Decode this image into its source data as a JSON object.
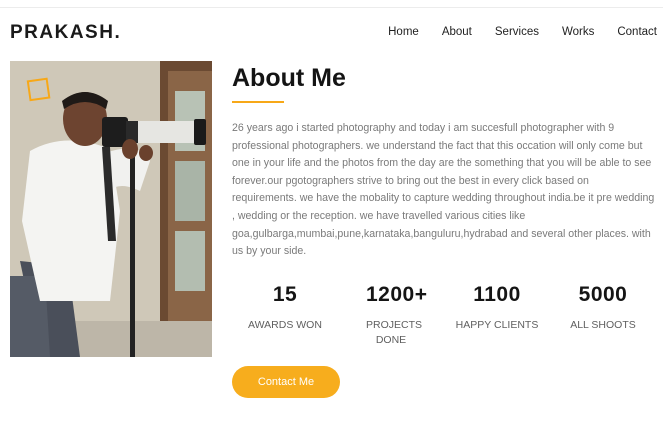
{
  "header": {
    "brand": "PRAKASH.",
    "nav": [
      {
        "label": "Home"
      },
      {
        "label": "About"
      },
      {
        "label": "Services"
      },
      {
        "label": "Works"
      },
      {
        "label": "Contact"
      }
    ]
  },
  "about": {
    "title": "About Me",
    "accent_color": "#f7a818",
    "description": "26 years ago i started photography and today i am succesfull photographer with 9 professional photographers. we understand the fact that this occation will only come but one in your life and the photos from the day are the something that you will be able to see forever.our pgotographers strive to bring out the best in every click based on requirements. we have the mobality to capture wedding throughout india.be it pre wedding , wedding or the reception. we have travelled various cities like goa,gulbarga,mumbai,pune,karnataka,banguluru,hydrabad and several other places. with us by your side.",
    "stats": [
      {
        "value": "15",
        "label": "AWARDS WON"
      },
      {
        "value": "1200+",
        "label": "PROJECTS DONE"
      },
      {
        "value": "1100",
        "label": "HAPPY CLIENTS"
      },
      {
        "value": "5000",
        "label": "ALL SHOOTS"
      }
    ],
    "cta_label": "Contact Me",
    "cta_color": "#f7ad1d"
  },
  "photo": {
    "icon": "photographer-portrait"
  }
}
